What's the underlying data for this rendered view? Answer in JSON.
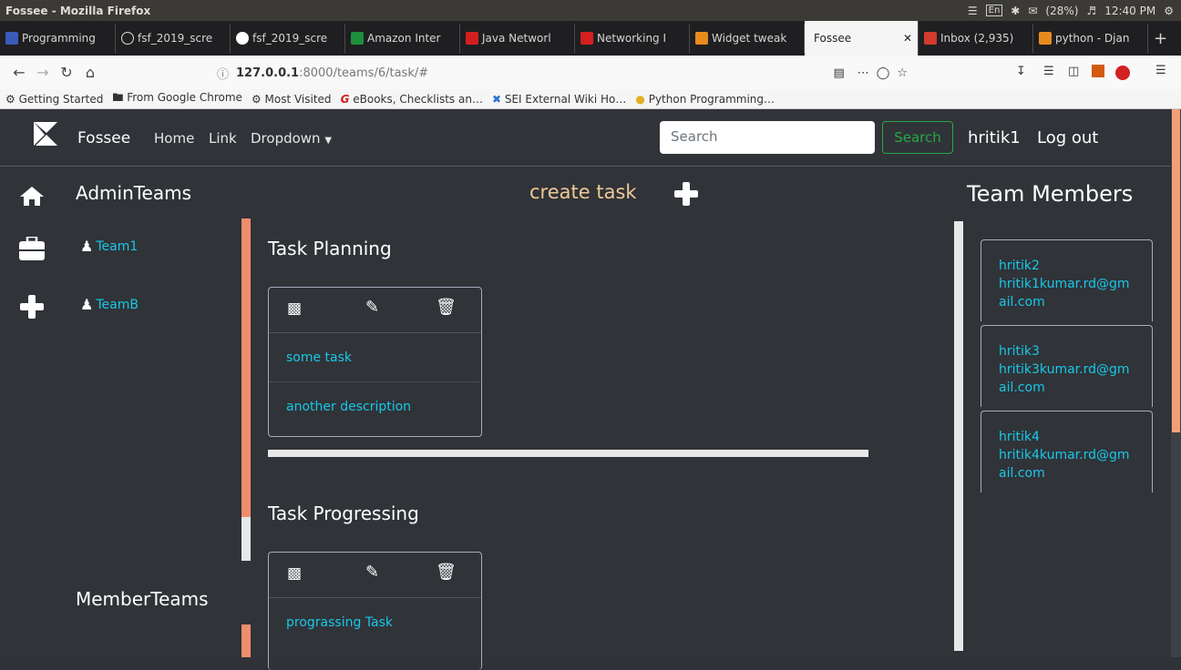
{
  "os": {
    "window_title": "Fossee - Mozilla Firefox",
    "lang": "En",
    "battery": "(28%)",
    "clock": "12:40 PM"
  },
  "tabs": [
    {
      "label": "Programming",
      "color": "#3b5bbb"
    },
    {
      "label": "fsf_2019_scre",
      "color": "#222222"
    },
    {
      "label": "fsf_2019_scre",
      "color": "#ffffff"
    },
    {
      "label": "Amazon Inter",
      "color": "#1e8f3a"
    },
    {
      "label": "Java Networl",
      "color": "#d31f1f"
    },
    {
      "label": "Networking I",
      "color": "#d31f1f"
    },
    {
      "label": "Widget tweak",
      "color": "#e88b1f"
    },
    {
      "label": "Fossee",
      "color": ""
    },
    {
      "label": "Inbox (2,935)",
      "color": "#d33b2c"
    },
    {
      "label": "python - Djan",
      "color": "#e88b1f"
    }
  ],
  "url": {
    "host": "127.0.0.1",
    "path": ":8000/teams/6/task/#"
  },
  "bookmarks": [
    "Getting Started",
    "From Google Chrome",
    "Most Visited",
    "eBooks, Checklists an…",
    "SEI External Wiki Ho…",
    "Python Programming…"
  ],
  "nav": {
    "brand": "Fossee",
    "home": "Home",
    "link": "Link",
    "dropdown": "Dropdown",
    "search_placeholder": "Search",
    "search_button": "Search",
    "user": "hritik1",
    "logout": "Log out"
  },
  "sidebar": {
    "admin_heading": "AdminTeams",
    "member_heading": "MemberTeams",
    "teams": [
      "Team1",
      "TeamB"
    ]
  },
  "create_task": "create task",
  "sections": [
    {
      "title": "Task Planning",
      "items": [
        "some task",
        "another description"
      ]
    },
    {
      "title": "Task Progressing",
      "items": [
        "prograssing Task"
      ]
    }
  ],
  "members_heading": "Team Members",
  "members": [
    {
      "name": "hritik2",
      "email": "hritik1kumar.rd@gmail.com"
    },
    {
      "name": "hritik3",
      "email": "hritik3kumar.rd@gmail.com"
    },
    {
      "name": "hritik4",
      "email": "hritik4kumar.rd@gmail.com"
    }
  ]
}
